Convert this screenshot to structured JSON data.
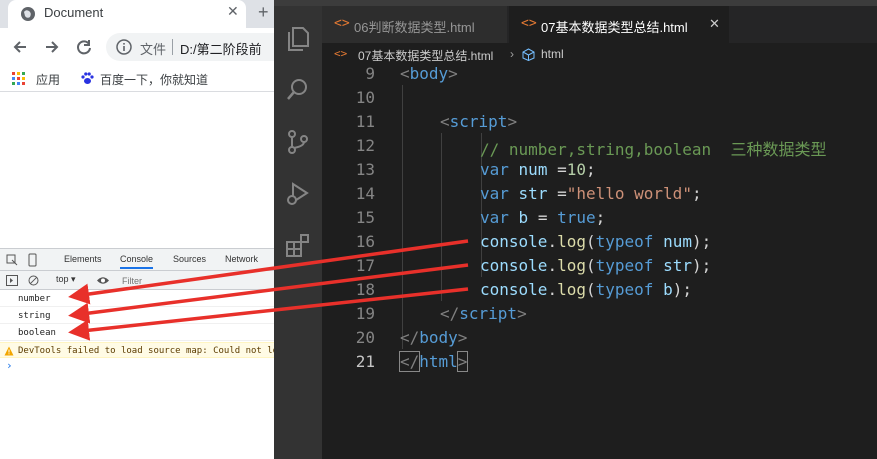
{
  "browser": {
    "tab_title": "Document",
    "tab_close": "✕",
    "new_tab": "+",
    "omnibox_label": "文件",
    "omnibox_url": "D:/第二阶段前",
    "bookmarks": [
      {
        "label": "应用"
      },
      {
        "label": "百度一下，你就知道"
      }
    ]
  },
  "devtools": {
    "tabs": [
      "Elements",
      "Console",
      "Sources",
      "Network"
    ],
    "context": "top ▾",
    "filter_placeholder": "Filter",
    "console_lines": [
      "number",
      "string",
      "boolean"
    ],
    "warning": "DevTools failed to load source map: Could not load",
    "prompt": "›"
  },
  "editor": {
    "tabs": [
      {
        "label": "06判断数据类型.html",
        "active": false
      },
      {
        "label": "07基本数据类型总结.html",
        "active": true
      }
    ],
    "tab_close": "✕",
    "breadcrumb": [
      "07基本数据类型总结.html",
      "›",
      "html"
    ],
    "lines": [
      {
        "n": "9"
      },
      {
        "n": "10"
      },
      {
        "n": "11"
      },
      {
        "n": "12"
      },
      {
        "n": "13"
      },
      {
        "n": "14"
      },
      {
        "n": "15"
      },
      {
        "n": "16"
      },
      {
        "n": "17"
      },
      {
        "n": "18"
      },
      {
        "n": "19"
      },
      {
        "n": "20"
      },
      {
        "n": "21"
      }
    ],
    "active_line": "21",
    "tok": {
      "lt": "<",
      "gt": ">",
      "lts": "</",
      "body": "body",
      "script": "script",
      "html": "html",
      "comment": "// number,string,boolean  三种数据类型",
      "var": "var",
      "num": "num",
      "str": "str",
      "b": "b",
      "eq1": " =",
      "eq2": " =",
      "eq3": " = ",
      "ten": "10",
      "semi": ";",
      "hello": "\"hello world\"",
      "true": "true",
      "console": "console",
      "dot": ".",
      "log": "log",
      "lp": "(",
      "rp": ")",
      "typeof": "typeof",
      "sp": " "
    }
  },
  "colors": {
    "arrow": "#e8302a",
    "vscode_bg": "#1e1e1e",
    "keyword": "#569cd6",
    "string": "#ce9178",
    "comment": "#6a9955"
  }
}
